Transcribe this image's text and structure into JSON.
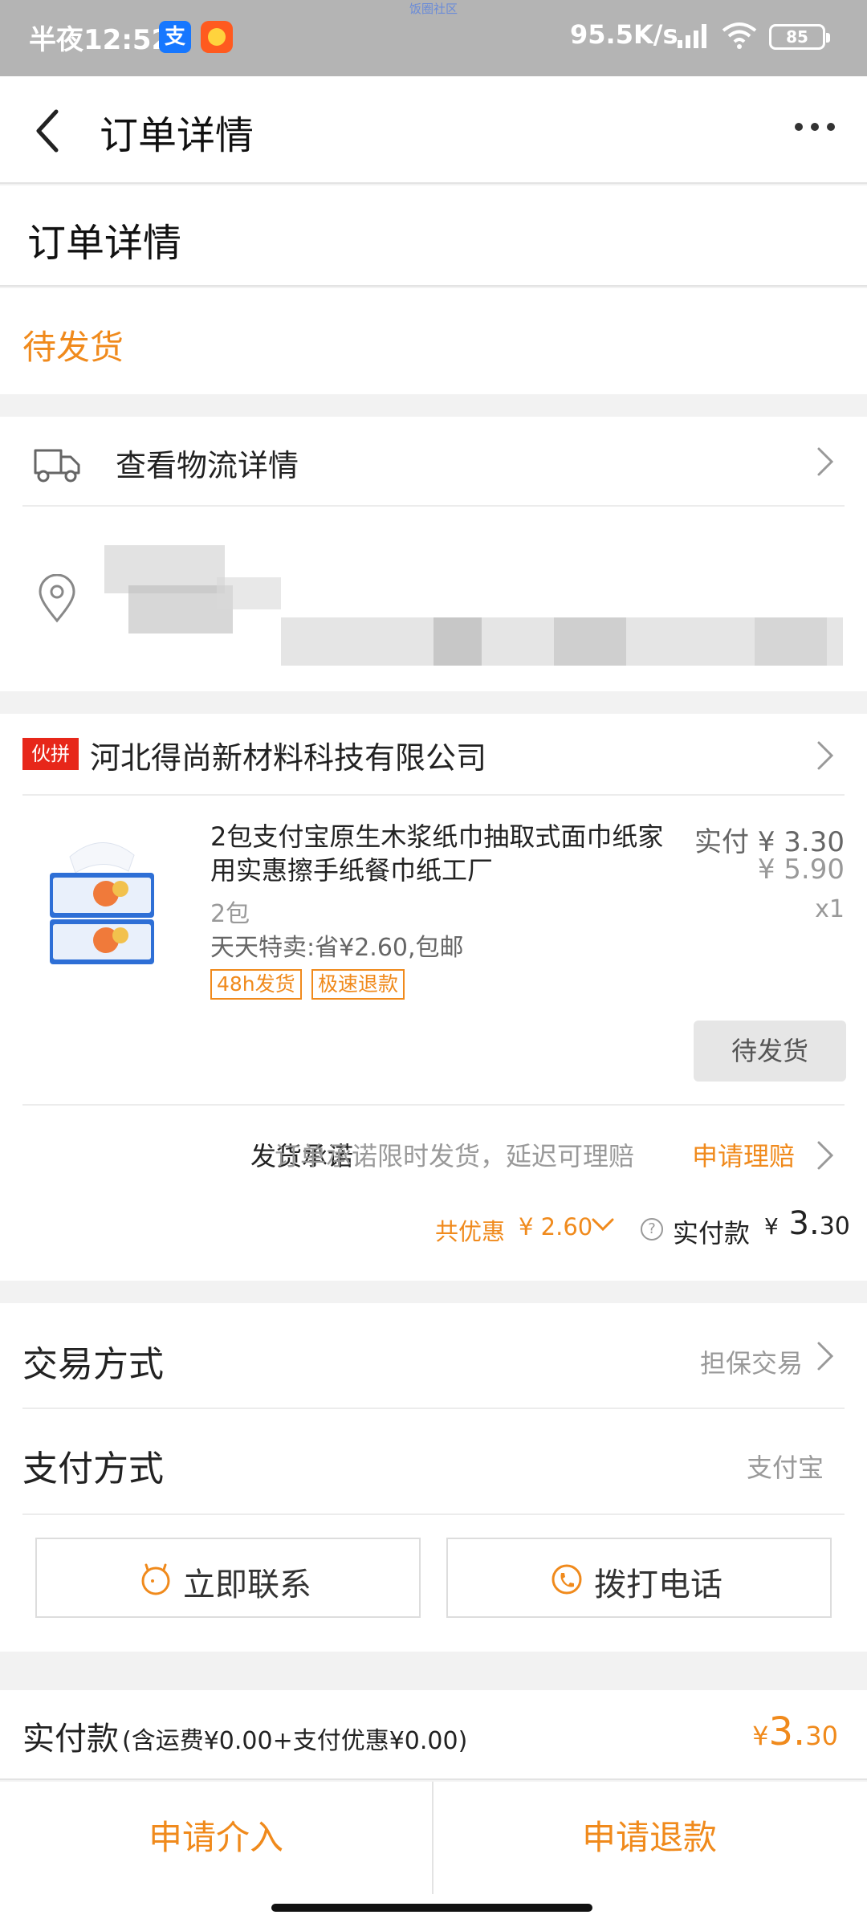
{
  "status_bar": {
    "time": "半夜12:52",
    "carrier_watermark": "饭圈社区",
    "network_speed": "95.5K/s",
    "battery": "85"
  },
  "header": {
    "title": "订单详情",
    "back_icon": "chevron-left-icon",
    "more_icon": "more-horizontal-icon"
  },
  "sub_title": "订单详情",
  "order_status": "待发货",
  "logistics": {
    "label": "查看物流详情"
  },
  "shop": {
    "badge": "伙拼",
    "name": "河北得尚新材料科技有限公司",
    "product": {
      "title": "2包支付宝原生木浆纸巾抽取式面巾纸家用实惠擦手纸餐巾纸工厂",
      "paid_price": "实付 ¥ 3.30",
      "original_price": "¥ 5.90",
      "quantity": "x1",
      "spec": "2包",
      "promo": "天天特卖:省¥2.60,包邮",
      "tags": [
        "48h发货",
        "极速退款"
      ],
      "status_button": "待发货"
    },
    "promise": {
      "title": "发货承诺",
      "text": "订单承诺限时发货，延迟可理赔",
      "action": "申请理赔"
    },
    "totals": {
      "discount_label": "共优惠",
      "discount_value": "¥ 2.60",
      "paid_label": "实付款",
      "paid_yen": "¥",
      "paid_int": "3.",
      "paid_dec": "30"
    }
  },
  "trade": {
    "rows": [
      {
        "label": "交易方式",
        "value": "担保交易"
      },
      {
        "label": "支付方式",
        "value": "支付宝"
      }
    ],
    "contact_button": "立即联系",
    "call_button": "拨打电话"
  },
  "summary": {
    "label": "实付款",
    "detail": "(含运费¥0.00+支付优惠¥0.00)",
    "yen": "¥",
    "int": "3.",
    "dec": "30"
  },
  "bottom_actions": {
    "intervene": "申请介入",
    "refund": "申请退款"
  },
  "colors": {
    "accent": "#f08a1c",
    "badge_red": "#e7271a",
    "status_bar": "#b4b4b4"
  }
}
